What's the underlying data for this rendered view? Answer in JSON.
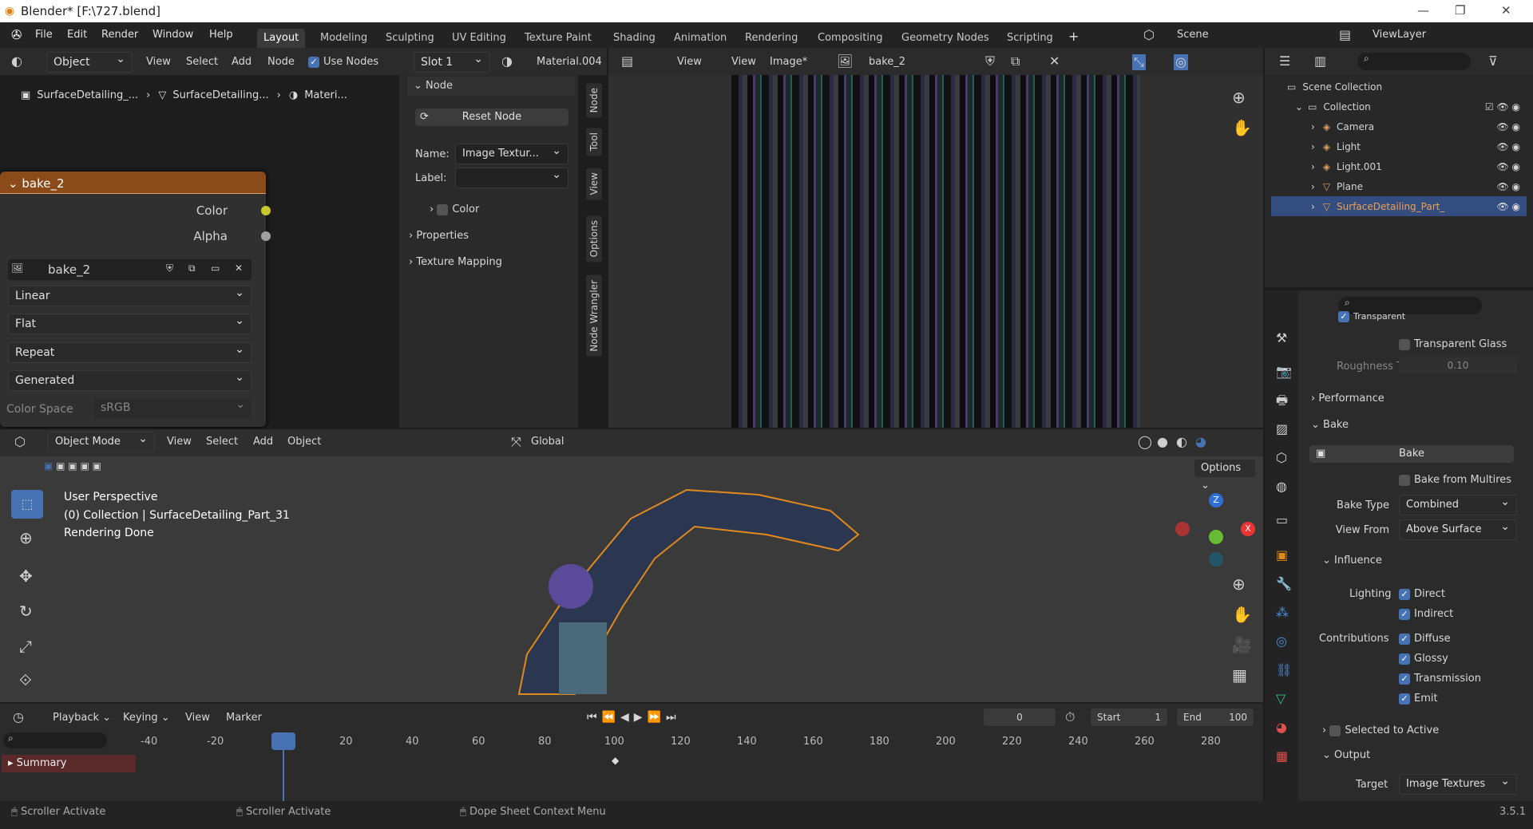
{
  "title": "Blender* [F:\\727.blend]",
  "menu": [
    "File",
    "Edit",
    "Render",
    "Window",
    "Help"
  ],
  "workspaces": [
    "Layout",
    "Modeling",
    "Sculpting",
    "UV Editing",
    "Texture Paint",
    "Shading",
    "Animation",
    "Rendering",
    "Compositing",
    "Geometry Nodes",
    "Scripting"
  ],
  "scene": "Scene",
  "viewlayer": "ViewLayer",
  "node_header": {
    "object": "Object",
    "view": "View",
    "select": "Select",
    "add": "Add",
    "node": "Node",
    "use_nodes": "Use Nodes",
    "slot": "Slot 1",
    "material": "Material.004"
  },
  "breadcrumb": [
    "SurfaceDetailing_...",
    "SurfaceDetailing...",
    "Materi..."
  ],
  "node": {
    "title": "bake_2",
    "out_color": "Color",
    "out_alpha": "Alpha",
    "image": "bake_2",
    "interp": "Linear",
    "proj": "Flat",
    "ext": "Repeat",
    "source": "Generated",
    "cs_label": "Color Space",
    "cs_value": "sRGB"
  },
  "npanel": {
    "node_title": "Node",
    "reset": "Reset Node",
    "name_label": "Name:",
    "name_value": "Image Textur...",
    "label_label": "Label:",
    "color": "Color",
    "properties": "Properties",
    "texmap": "Texture Mapping",
    "tabs": [
      "Node",
      "Tool",
      "View",
      "Options",
      "Node Wrangler"
    ]
  },
  "image_editor": {
    "view": "View",
    "view2": "View",
    "image": "Image*",
    "name": "bake_2"
  },
  "outliner": {
    "scene_coll": "Scene Collection",
    "collection": "Collection",
    "items": [
      "Camera",
      "Light",
      "Light.001",
      "Plane",
      "SurfaceDetailing_Part_"
    ]
  },
  "props": {
    "transparent": "Transparent",
    "transparent_glass": "Transparent Glass",
    "roughness_label": "Roughness T...",
    "roughness_value": "0.10",
    "performance": "Performance",
    "bake": "Bake",
    "bake_btn": "Bake",
    "bake_multires": "Bake from Multires",
    "bake_type_label": "Bake Type",
    "bake_type": "Combined",
    "view_from_label": "View From",
    "view_from": "Above Surface",
    "influence": "Influence",
    "lighting": "Lighting",
    "direct": "Direct",
    "indirect": "Indirect",
    "contributions": "Contributions",
    "diffuse": "Diffuse",
    "glossy": "Glossy",
    "transmission": "Transmission",
    "emit": "Emit",
    "selected_active": "Selected to Active",
    "output": "Output",
    "target_label": "Target",
    "target": "Image Textures"
  },
  "viewport": {
    "mode": "Object Mode",
    "view": "View",
    "select": "Select",
    "add": "Add",
    "object": "Object",
    "orient": "Global",
    "options": "Options",
    "info1": "User Perspective",
    "info2": "(0) Collection | SurfaceDetailing_Part_31",
    "info3": "Rendering Done"
  },
  "timeline": {
    "playback": "Playback",
    "keying": "Keying",
    "view": "View",
    "marker": "Marker",
    "frame": "0",
    "start_label": "Start",
    "start": "1",
    "end_label": "End",
    "end": "100",
    "ticks": [
      "-40",
      "-20",
      "0",
      "20",
      "40",
      "60",
      "80",
      "100",
      "120",
      "140",
      "160",
      "180",
      "200",
      "220",
      "240",
      "260",
      "280"
    ],
    "summary": "Summary"
  },
  "status": {
    "s1": "Scroller Activate",
    "s2": "Scroller Activate",
    "s3": "Dope Sheet Context Menu",
    "version": "3.5.1"
  },
  "colors": {
    "accent": "#4772b3",
    "node_header": "#8a4a1a",
    "selected": "#334d80",
    "orange": "#e08a1e"
  }
}
